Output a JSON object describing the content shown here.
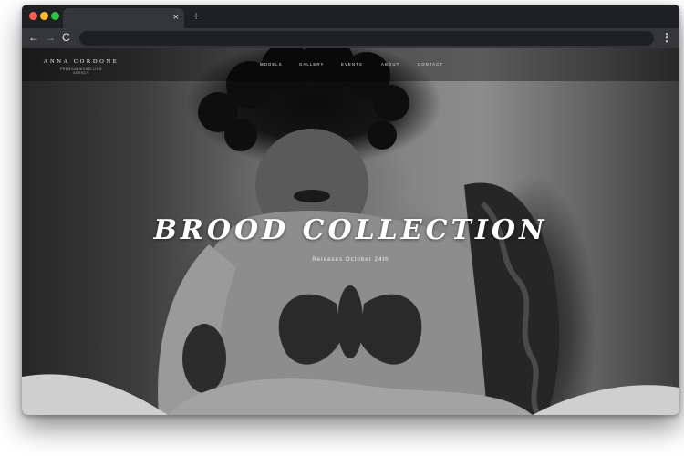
{
  "browser": {
    "tab_close_glyph": "×",
    "new_tab_glyph": "+",
    "back_glyph": "←",
    "forward_glyph": "→",
    "reload_glyph": "C",
    "menu_glyph": "⋮",
    "address": ""
  },
  "site": {
    "brand": {
      "name": "ANNA CORDONE",
      "tagline": "PREMIUM MODELLING",
      "sub": "AGENCY"
    },
    "nav": [
      {
        "label": "MODELS"
      },
      {
        "label": "GALLERY"
      },
      {
        "label": "EVENTS"
      },
      {
        "label": "ABOUT"
      },
      {
        "label": "CONTACT"
      }
    ]
  },
  "hero": {
    "title": "BROOD COLLECTION",
    "subtitle": "Releases October 24th"
  },
  "colors": {
    "window_chrome": "#1f2023",
    "toolbar": "#35363a",
    "traffic_red": "#ff5f57",
    "traffic_yellow": "#febc2e",
    "traffic_green": "#28c840",
    "hero_text": "#ffffff"
  }
}
